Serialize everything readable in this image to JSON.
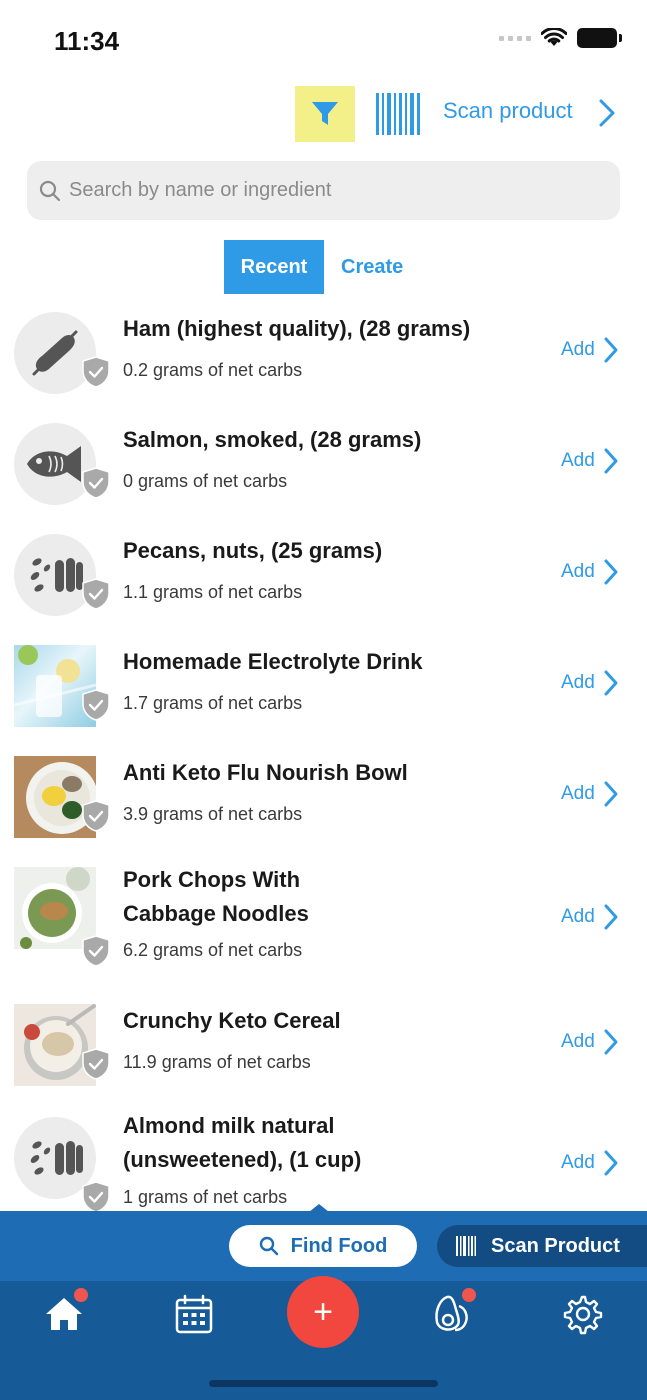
{
  "status": {
    "time": "11:34"
  },
  "toolbar": {
    "scan_label": "Scan product"
  },
  "search": {
    "placeholder": "Search by name or ingredient",
    "value": ""
  },
  "tabs": [
    {
      "label": "Recent"
    },
    {
      "label": "Create"
    }
  ],
  "colors": {
    "accent": "#2f9be6",
    "filter_highlight": "#f3f08a",
    "nav_blue": "#165a98",
    "plus_red": "#f2473f"
  },
  "foods": [
    {
      "title": "Ham (highest quality), (28 grams)",
      "subtitle": "0.2 grams of net carbs",
      "action": "Add",
      "icon": "sausage-icon"
    },
    {
      "title": "Salmon, smoked, (28 grams)",
      "subtitle": "0 grams of net carbs",
      "action": "Add",
      "icon": "fish-icon"
    },
    {
      "title": "Pecans, nuts, (25 grams)",
      "subtitle": "1.1 grams of net carbs",
      "action": "Add",
      "icon": "nuts-icon"
    },
    {
      "title": "Homemade Electrolyte Drink",
      "subtitle": "1.7 grams of net carbs",
      "action": "Add",
      "icon": "drink-photo"
    },
    {
      "title": "Anti Keto Flu Nourish Bowl",
      "subtitle": "3.9 grams of net carbs",
      "action": "Add",
      "icon": "bowl-photo"
    },
    {
      "title": "Pork Chops With Cabbage Noodles",
      "subtitle": "6.2 grams of net carbs",
      "action": "Add",
      "icon": "pork-photo"
    },
    {
      "title": "Crunchy Keto Cereal",
      "subtitle": "11.9 grams of net carbs",
      "action": "Add",
      "icon": "cereal-photo"
    },
    {
      "title": "Almond milk natural (unsweetened), (1 cup)",
      "subtitle": "1 grams of net carbs",
      "action": "Add",
      "icon": "nuts-icon"
    }
  ],
  "bottom": {
    "find_food": "Find Food",
    "scan_product": "Scan Product",
    "plus": "+"
  }
}
